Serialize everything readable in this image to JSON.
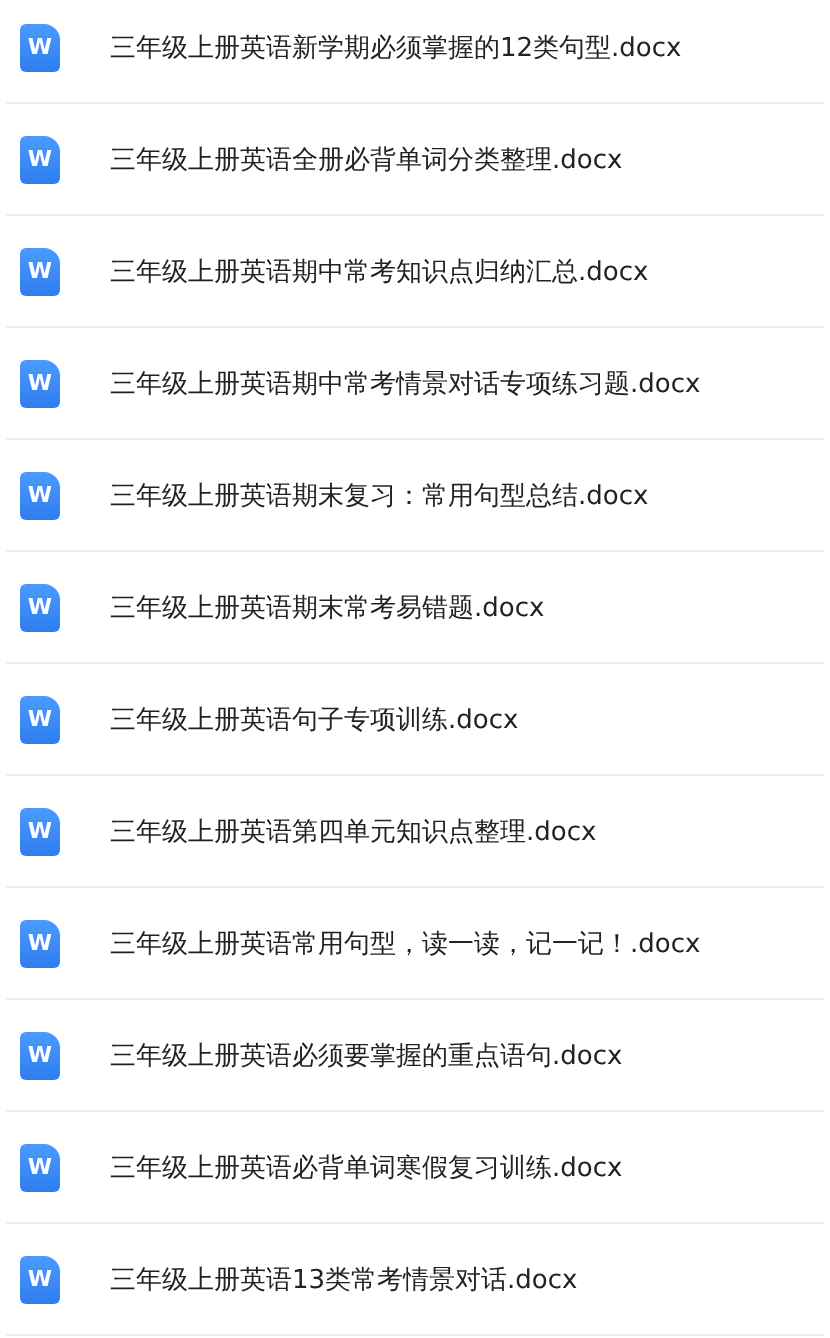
{
  "files": [
    {
      "icon": "W",
      "name": "三年级上册英语新学期必须掌握的12类句型.docx"
    },
    {
      "icon": "W",
      "name": "三年级上册英语全册必背单词分类整理.docx"
    },
    {
      "icon": "W",
      "name": "三年级上册英语期中常考知识点归纳汇总.docx"
    },
    {
      "icon": "W",
      "name": "三年级上册英语期中常考情景对话专项练习题.docx"
    },
    {
      "icon": "W",
      "name": "三年级上册英语期末复习：常用句型总结.docx"
    },
    {
      "icon": "W",
      "name": "三年级上册英语期末常考易错题.docx"
    },
    {
      "icon": "W",
      "name": "三年级上册英语句子专项训练.docx"
    },
    {
      "icon": "W",
      "name": "三年级上册英语第四单元知识点整理.docx"
    },
    {
      "icon": "W",
      "name": "三年级上册英语常用句型，读一读，记一记！.docx"
    },
    {
      "icon": "W",
      "name": "三年级上册英语必须要掌握的重点语句.docx"
    },
    {
      "icon": "W",
      "name": "三年级上册英语必背单词寒假复习训练.docx"
    },
    {
      "icon": "W",
      "name": "三年级上册英语13类常考情景对话.docx"
    }
  ]
}
